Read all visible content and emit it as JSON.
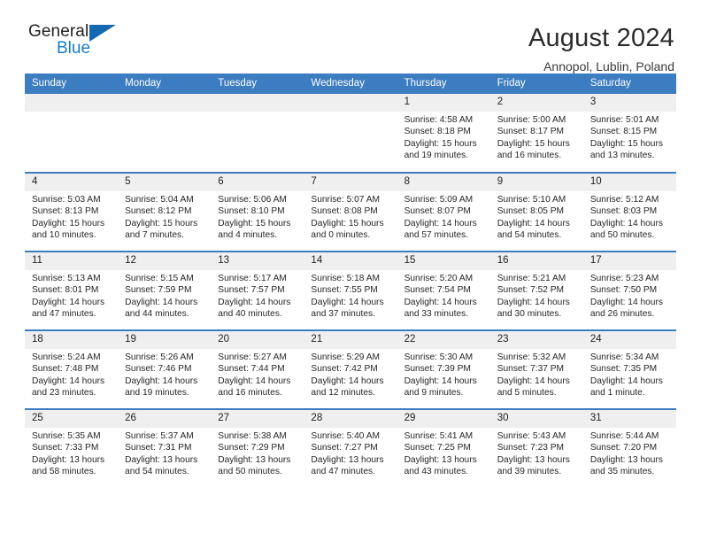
{
  "brand": {
    "name_top": "General",
    "name_bottom": "Blue",
    "triangle_color": "#1569b0",
    "blue_text_color": "#1a7bc4"
  },
  "header": {
    "title": "August 2024",
    "location": "Annopol, Lublin, Poland"
  },
  "theme": {
    "header_blue": "#3c7cc0",
    "daynum_gray": "#efefef"
  },
  "weekday_headers": [
    "Sunday",
    "Monday",
    "Tuesday",
    "Wednesday",
    "Thursday",
    "Friday",
    "Saturday"
  ],
  "weeks": [
    [
      {
        "day": "",
        "empty": true,
        "lines": []
      },
      {
        "day": "",
        "empty": true,
        "lines": []
      },
      {
        "day": "",
        "empty": true,
        "lines": []
      },
      {
        "day": "",
        "empty": true,
        "lines": []
      },
      {
        "day": "1",
        "empty": false,
        "lines": [
          "Sunrise: 4:58 AM",
          "Sunset: 8:18 PM",
          "Daylight: 15 hours",
          "and 19 minutes."
        ]
      },
      {
        "day": "2",
        "empty": false,
        "lines": [
          "Sunrise: 5:00 AM",
          "Sunset: 8:17 PM",
          "Daylight: 15 hours",
          "and 16 minutes."
        ]
      },
      {
        "day": "3",
        "empty": false,
        "lines": [
          "Sunrise: 5:01 AM",
          "Sunset: 8:15 PM",
          "Daylight: 15 hours",
          "and 13 minutes."
        ]
      }
    ],
    [
      {
        "day": "4",
        "empty": false,
        "lines": [
          "Sunrise: 5:03 AM",
          "Sunset: 8:13 PM",
          "Daylight: 15 hours",
          "and 10 minutes."
        ]
      },
      {
        "day": "5",
        "empty": false,
        "lines": [
          "Sunrise: 5:04 AM",
          "Sunset: 8:12 PM",
          "Daylight: 15 hours",
          "and 7 minutes."
        ]
      },
      {
        "day": "6",
        "empty": false,
        "lines": [
          "Sunrise: 5:06 AM",
          "Sunset: 8:10 PM",
          "Daylight: 15 hours",
          "and 4 minutes."
        ]
      },
      {
        "day": "7",
        "empty": false,
        "lines": [
          "Sunrise: 5:07 AM",
          "Sunset: 8:08 PM",
          "Daylight: 15 hours",
          "and 0 minutes."
        ]
      },
      {
        "day": "8",
        "empty": false,
        "lines": [
          "Sunrise: 5:09 AM",
          "Sunset: 8:07 PM",
          "Daylight: 14 hours",
          "and 57 minutes."
        ]
      },
      {
        "day": "9",
        "empty": false,
        "lines": [
          "Sunrise: 5:10 AM",
          "Sunset: 8:05 PM",
          "Daylight: 14 hours",
          "and 54 minutes."
        ]
      },
      {
        "day": "10",
        "empty": false,
        "lines": [
          "Sunrise: 5:12 AM",
          "Sunset: 8:03 PM",
          "Daylight: 14 hours",
          "and 50 minutes."
        ]
      }
    ],
    [
      {
        "day": "11",
        "empty": false,
        "lines": [
          "Sunrise: 5:13 AM",
          "Sunset: 8:01 PM",
          "Daylight: 14 hours",
          "and 47 minutes."
        ]
      },
      {
        "day": "12",
        "empty": false,
        "lines": [
          "Sunrise: 5:15 AM",
          "Sunset: 7:59 PM",
          "Daylight: 14 hours",
          "and 44 minutes."
        ]
      },
      {
        "day": "13",
        "empty": false,
        "lines": [
          "Sunrise: 5:17 AM",
          "Sunset: 7:57 PM",
          "Daylight: 14 hours",
          "and 40 minutes."
        ]
      },
      {
        "day": "14",
        "empty": false,
        "lines": [
          "Sunrise: 5:18 AM",
          "Sunset: 7:55 PM",
          "Daylight: 14 hours",
          "and 37 minutes."
        ]
      },
      {
        "day": "15",
        "empty": false,
        "lines": [
          "Sunrise: 5:20 AM",
          "Sunset: 7:54 PM",
          "Daylight: 14 hours",
          "and 33 minutes."
        ]
      },
      {
        "day": "16",
        "empty": false,
        "lines": [
          "Sunrise: 5:21 AM",
          "Sunset: 7:52 PM",
          "Daylight: 14 hours",
          "and 30 minutes."
        ]
      },
      {
        "day": "17",
        "empty": false,
        "lines": [
          "Sunrise: 5:23 AM",
          "Sunset: 7:50 PM",
          "Daylight: 14 hours",
          "and 26 minutes."
        ]
      }
    ],
    [
      {
        "day": "18",
        "empty": false,
        "lines": [
          "Sunrise: 5:24 AM",
          "Sunset: 7:48 PM",
          "Daylight: 14 hours",
          "and 23 minutes."
        ]
      },
      {
        "day": "19",
        "empty": false,
        "lines": [
          "Sunrise: 5:26 AM",
          "Sunset: 7:46 PM",
          "Daylight: 14 hours",
          "and 19 minutes."
        ]
      },
      {
        "day": "20",
        "empty": false,
        "lines": [
          "Sunrise: 5:27 AM",
          "Sunset: 7:44 PM",
          "Daylight: 14 hours",
          "and 16 minutes."
        ]
      },
      {
        "day": "21",
        "empty": false,
        "lines": [
          "Sunrise: 5:29 AM",
          "Sunset: 7:42 PM",
          "Daylight: 14 hours",
          "and 12 minutes."
        ]
      },
      {
        "day": "22",
        "empty": false,
        "lines": [
          "Sunrise: 5:30 AM",
          "Sunset: 7:39 PM",
          "Daylight: 14 hours",
          "and 9 minutes."
        ]
      },
      {
        "day": "23",
        "empty": false,
        "lines": [
          "Sunrise: 5:32 AM",
          "Sunset: 7:37 PM",
          "Daylight: 14 hours",
          "and 5 minutes."
        ]
      },
      {
        "day": "24",
        "empty": false,
        "lines": [
          "Sunrise: 5:34 AM",
          "Sunset: 7:35 PM",
          "Daylight: 14 hours",
          "and 1 minute."
        ]
      }
    ],
    [
      {
        "day": "25",
        "empty": false,
        "lines": [
          "Sunrise: 5:35 AM",
          "Sunset: 7:33 PM",
          "Daylight: 13 hours",
          "and 58 minutes."
        ]
      },
      {
        "day": "26",
        "empty": false,
        "lines": [
          "Sunrise: 5:37 AM",
          "Sunset: 7:31 PM",
          "Daylight: 13 hours",
          "and 54 minutes."
        ]
      },
      {
        "day": "27",
        "empty": false,
        "lines": [
          "Sunrise: 5:38 AM",
          "Sunset: 7:29 PM",
          "Daylight: 13 hours",
          "and 50 minutes."
        ]
      },
      {
        "day": "28",
        "empty": false,
        "lines": [
          "Sunrise: 5:40 AM",
          "Sunset: 7:27 PM",
          "Daylight: 13 hours",
          "and 47 minutes."
        ]
      },
      {
        "day": "29",
        "empty": false,
        "lines": [
          "Sunrise: 5:41 AM",
          "Sunset: 7:25 PM",
          "Daylight: 13 hours",
          "and 43 minutes."
        ]
      },
      {
        "day": "30",
        "empty": false,
        "lines": [
          "Sunrise: 5:43 AM",
          "Sunset: 7:23 PM",
          "Daylight: 13 hours",
          "and 39 minutes."
        ]
      },
      {
        "day": "31",
        "empty": false,
        "lines": [
          "Sunrise: 5:44 AM",
          "Sunset: 7:20 PM",
          "Daylight: 13 hours",
          "and 35 minutes."
        ]
      }
    ]
  ]
}
